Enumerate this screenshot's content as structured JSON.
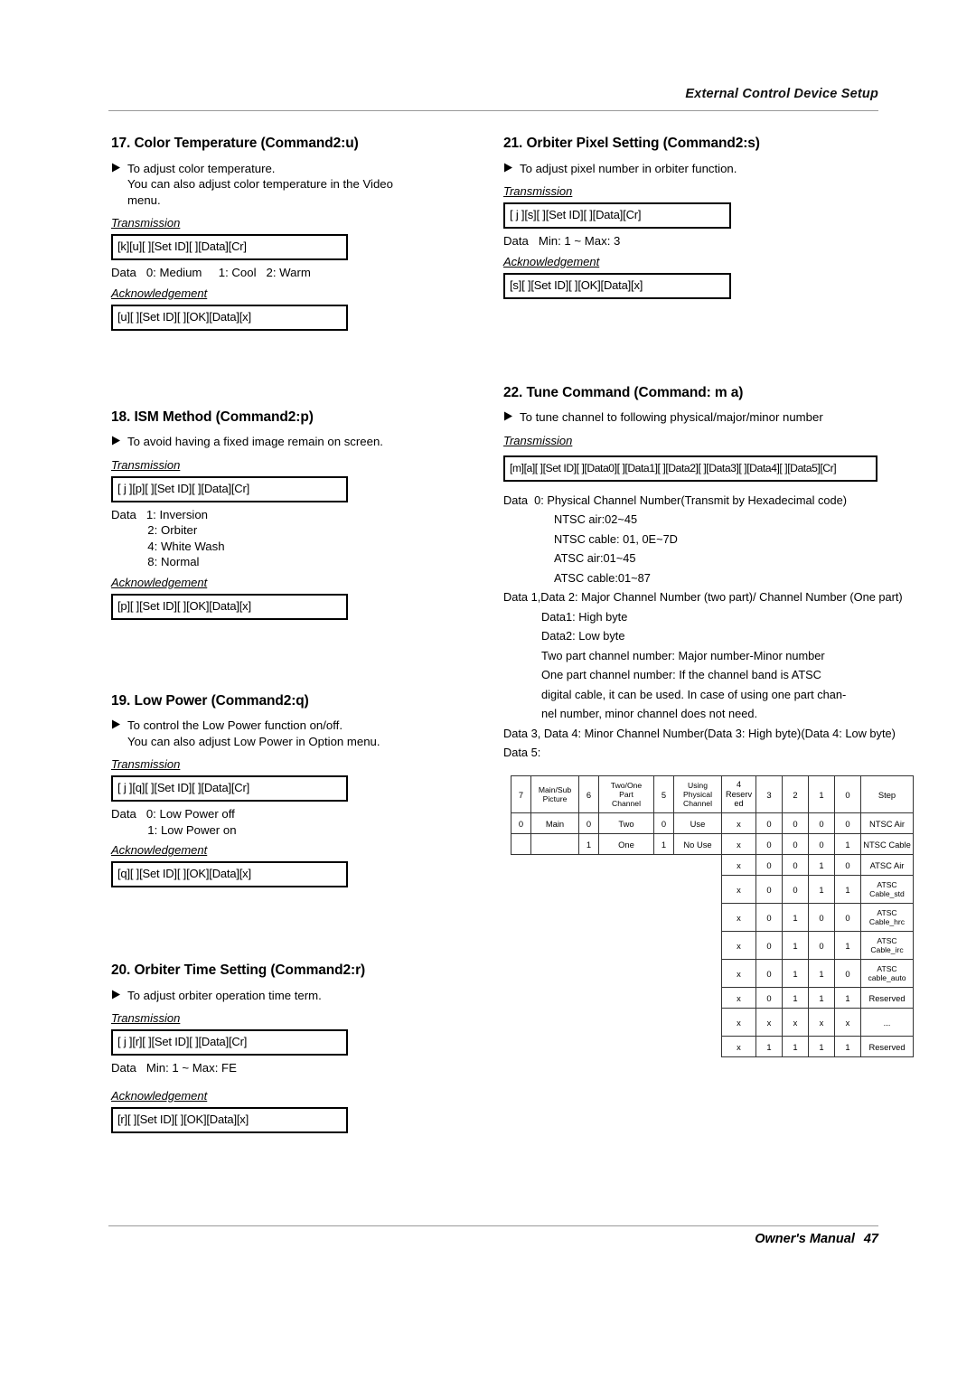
{
  "header": {
    "title": "External Control Device Setup"
  },
  "footer": {
    "manual": "Owner's Manual",
    "page": "47"
  },
  "labels": {
    "transmission": "Transmission",
    "acknowledgement": "Acknowledgement"
  },
  "left_column": [
    {
      "title": "17. Color Temperature (Command2:u)",
      "bullet": "To adjust color temperature.\nYou can also adjust color temperature in the Video\nmenu.",
      "transmission_box": "[k][u][  ][Set ID][  ][Data][Cr]",
      "data_line": "Data   0: Medium     1: Cool   2: Warm",
      "ack_box": "[u][  ][Set ID][  ][OK][Data][x]"
    },
    {
      "title": "18. ISM Method (Command2:p)",
      "bullet": "To avoid having a fixed image remain on screen.",
      "transmission_box": "[ j ][p][  ][Set ID][  ][Data][Cr]",
      "data_rows": [
        "Data   1: Inversion",
        "           2: Orbiter",
        "           4: White Wash",
        "           8: Normal"
      ],
      "ack_box": "[p][  ][Set ID][  ][OK][Data][x]"
    },
    {
      "title": "19. Low Power (Command2:q)",
      "bullet": "To control the Low Power function on/off.\nYou can also adjust Low Power in Option menu.",
      "transmission_box": "[ j ][q][  ][Set ID][  ][Data][Cr]",
      "data_rows": [
        "Data   0: Low Power off",
        "           1: Low Power on"
      ],
      "ack_box": "[q][  ][Set ID][  ][OK][Data][x]"
    },
    {
      "title": "20. Orbiter Time Setting (Command2:r)",
      "bullet": "To adjust orbiter operation time term.",
      "transmission_box": "[ j ][r][  ][Set ID][  ][Data][Cr]",
      "data_line": "Data   Min: 1 ~ Max: FE",
      "ack_box": "[r][  ][Set ID][  ][OK][Data][x]"
    }
  ],
  "right_column": [
    {
      "title": "21. Orbiter Pixel Setting (Command2:s)",
      "bullet": "To adjust pixel number in orbiter function.",
      "transmission_box": "[ j ][s][  ][Set ID][  ][Data][Cr]",
      "data_line": "Data   Min: 1 ~ Max: 3",
      "ack_box": "[s][  ][Set ID][  ][OK][Data][x]"
    },
    {
      "title": "22. Tune Command (Command: m a)",
      "bullet": "To tune channel to following physical/major/minor number",
      "transmission_box": "[m][a][  ][Set ID][  ][Data0][  ][Data1][  ][Data2][  ][Data3][  ][Data4][  ][Data5][Cr]"
    }
  ],
  "tune_detail": {
    "l1": "Data  0: Physical Channel Number(Transmit by Hexadecimal code)",
    "l2": "NTSC air:02~45",
    "l3": "NTSC cable: 01, 0E~7D",
    "l4": "ATSC air:01~45",
    "l5": "ATSC cable:01~87",
    "l6": "Data 1,Data 2: Major Channel Number (two part)/ Channel Number (One part)",
    "l7": "Data1: High byte",
    "l8": "Data2: Low byte",
    "l9": "Two part channel number: Major number-Minor number",
    "l10": "One part channel number: If the channel band is ATSC",
    "l11": "digital cable, it can be used. In case of using one part chan-",
    "l12": "nel number, minor channel does not need.",
    "l13": "Data 3, Data 4: Minor Channel Number(Data 3: High byte)(Data 4: Low byte)",
    "l14": "Data 5:"
  },
  "bit_table": {
    "header": [
      "7",
      "Main/Sub Picture",
      "6",
      "Two/One Part Channel",
      "5",
      "Using Physical Channel",
      "4 Reserved",
      "3",
      "2",
      "1",
      "0",
      "Step"
    ],
    "header_cells": {
      "bit7": "7",
      "name7": "Main/Sub\nPicture",
      "bit6": "6",
      "name6": "Two/One\nPart\nChannel",
      "bit5": "5",
      "name5": "Using\nPhysical\nChannel",
      "bit4": "4\nReserv\ned",
      "bit3": "3",
      "bit2": "2",
      "bit1": "1",
      "bit0": "0",
      "step": "Step"
    },
    "rows": [
      {
        "b7": "0",
        "n7": "Main",
        "b6": "0",
        "n6": "Two",
        "b5": "0",
        "n5": "Use",
        "b4": "x",
        "b3": "0",
        "b2": "0",
        "b1": "0",
        "b0": "0",
        "step": "NTSC Air"
      },
      {
        "b7": "",
        "n7": "",
        "b6": "1",
        "n6": "One",
        "b5": "1",
        "n5": "No Use",
        "b4": "x",
        "b3": "0",
        "b2": "0",
        "b1": "0",
        "b0": "1",
        "step": "NTSC Cable"
      },
      {
        "b4": "x",
        "b3": "0",
        "b2": "0",
        "b1": "1",
        "b0": "0",
        "step": "ATSC Air"
      },
      {
        "b4": "x",
        "b3": "0",
        "b2": "0",
        "b1": "1",
        "b0": "1",
        "step": "ATSC\nCable_std"
      },
      {
        "b4": "x",
        "b3": "0",
        "b2": "1",
        "b1": "0",
        "b0": "0",
        "step": "ATSC\nCable_hrc"
      },
      {
        "b4": "x",
        "b3": "0",
        "b2": "1",
        "b1": "0",
        "b0": "1",
        "step": "ATSC\nCable_irc"
      },
      {
        "b4": "x",
        "b3": "0",
        "b2": "1",
        "b1": "1",
        "b0": "0",
        "step": "ATSC\ncable_auto"
      },
      {
        "b4": "x",
        "b3": "0",
        "b2": "1",
        "b1": "1",
        "b0": "1",
        "step": "Reserved"
      },
      {
        "b4": "x",
        "b3": "x",
        "b2": "x",
        "b1": "x",
        "b0": "x",
        "step": "..."
      },
      {
        "b4": "x",
        "b3": "1",
        "b2": "1",
        "b1": "1",
        "b0": "1",
        "step": "Reserved"
      }
    ]
  }
}
